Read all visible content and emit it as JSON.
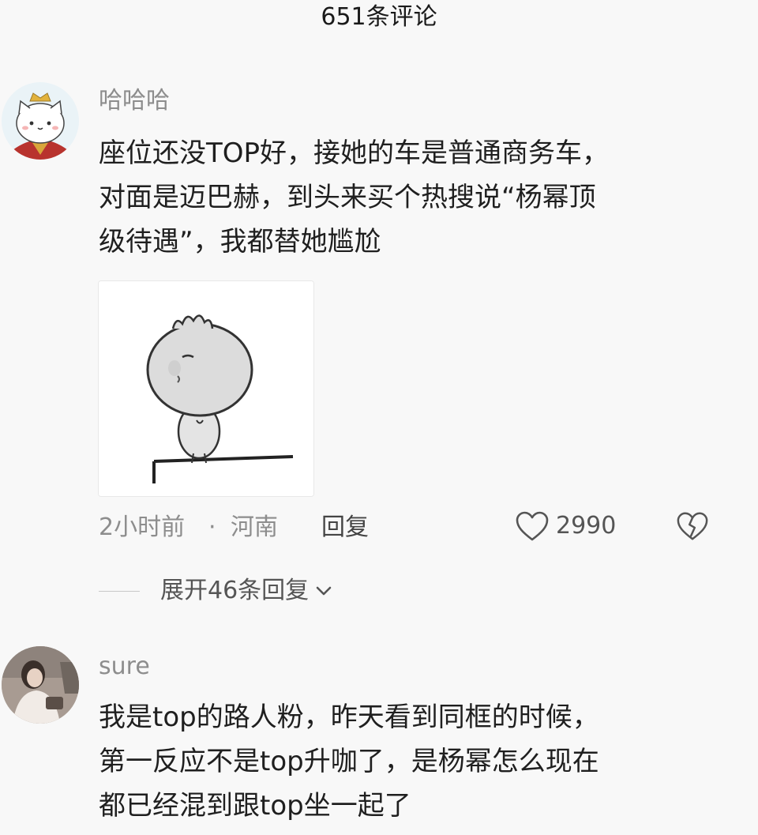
{
  "header": {
    "title": "651条评论"
  },
  "comments": [
    {
      "username": "哈哈哈",
      "text": "座位还没TOP好，接她的车是普通商务车，\n对面是迈巴赫，到头来买个热搜说“杨幂顶\n级待遇”，我都替她尴尬",
      "time": "2小时前",
      "separator": "·",
      "location": "河南",
      "reply_label": "回复",
      "likes": "2990",
      "expand_label": "展开46条回复"
    },
    {
      "username": "sure",
      "text": "我是top的路人粉，昨天看到同框的时候，\n第一反应不是top升咖了，是杨幂怎么现在\n都已经混到跟top坐一起了"
    }
  ],
  "icons": {
    "like": "heart-outline-icon",
    "dislike": "broken-heart-icon",
    "expand": "chevron-down-icon"
  }
}
